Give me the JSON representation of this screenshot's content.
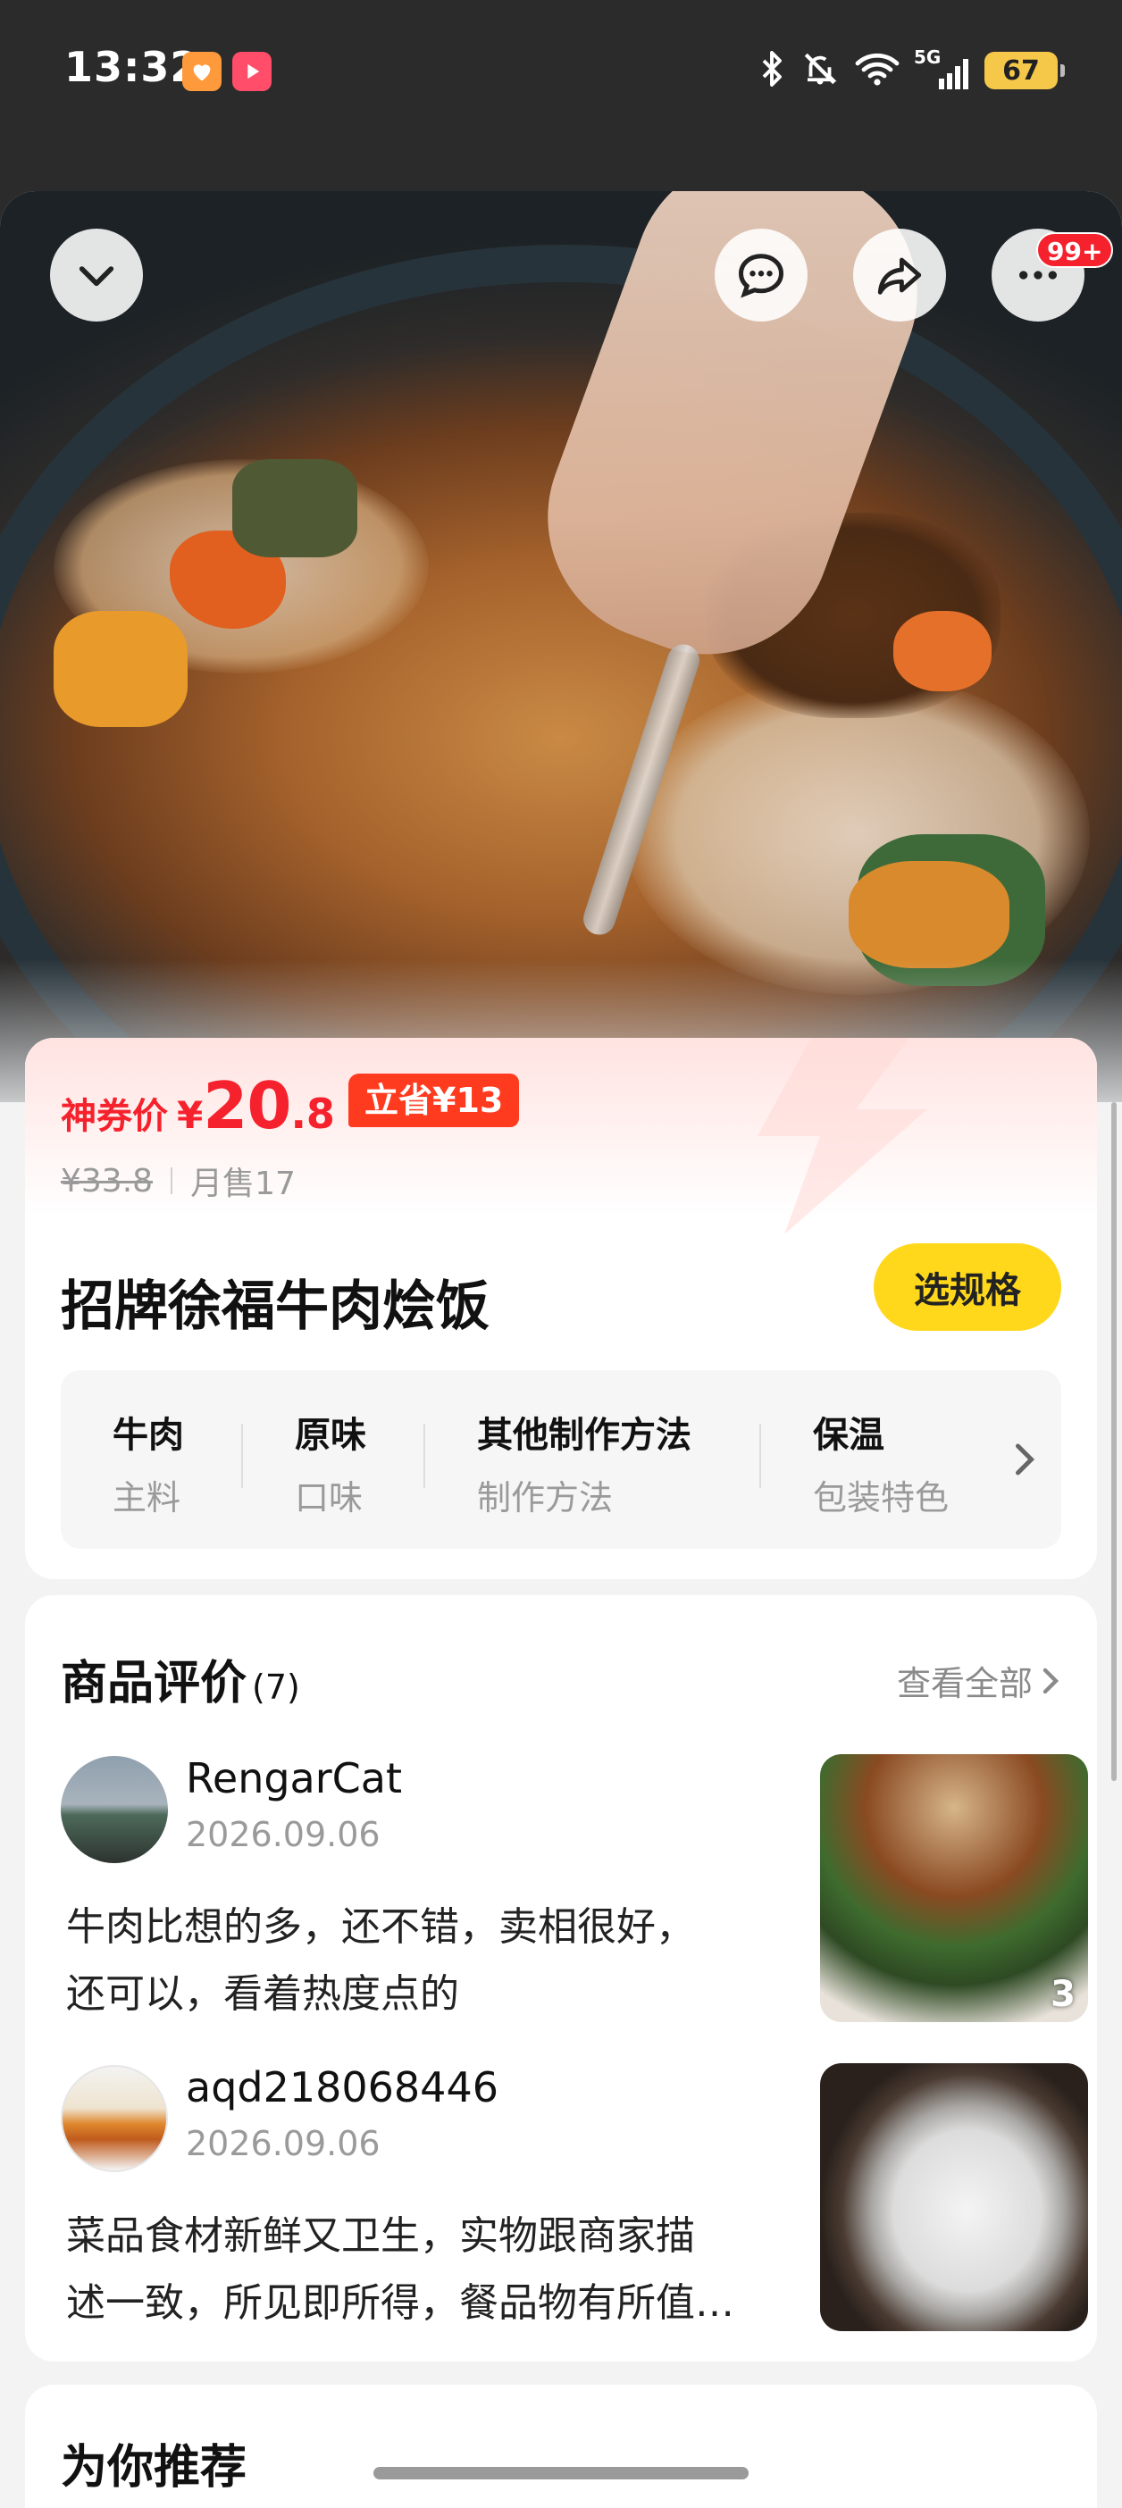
{
  "status_bar": {
    "time": "13:32",
    "network": "5G",
    "battery": "67",
    "icons": [
      "heart-app-icon",
      "video-app-icon",
      "bluetooth-icon",
      "mute-icon",
      "wifi-icon",
      "signal-icon",
      "battery-icon"
    ]
  },
  "header": {
    "more_badge": "99+",
    "icons": [
      "chevron-down-icon",
      "chat-icon",
      "share-icon",
      "more-icon"
    ]
  },
  "product": {
    "price_label": "神券价",
    "price_currency": "¥",
    "price_integer": "20",
    "price_decimal": ".8",
    "save_tag": "立省¥13",
    "original_price": "¥33.8",
    "monthly_sales": "月售17",
    "name": "招牌徐福牛肉烩饭",
    "spec_button": "选规格",
    "attributes": [
      {
        "value": "牛肉",
        "key": "主料"
      },
      {
        "value": "原味",
        "key": "口味"
      },
      {
        "value": "其他制作方法",
        "key": "制作方法"
      },
      {
        "value": "保温",
        "key": "包装特色"
      }
    ]
  },
  "reviews": {
    "title": "商品评价",
    "count": "(7)",
    "view_all": "查看全部",
    "items": [
      {
        "user": "RengarCat",
        "date": "2026.09.06",
        "line1": "牛肉比想的多，还不错，卖相很好，",
        "line2": "还可以，看着热度点的",
        "photo_count": "3"
      },
      {
        "user": "aqd218068446",
        "date": "2026.09.06",
        "line1": "菜品食材新鲜又卫生，实物跟商家描",
        "line2": "述一致，所见即所得，餐品物有所值…"
      }
    ]
  },
  "recommend": {
    "title": "为你推荐"
  },
  "colors": {
    "price_red": "#f5222d",
    "save_tag": "#ff3b1f",
    "spec_button": "#ffd81c",
    "status_bar_bg": "#2b2b2b"
  }
}
